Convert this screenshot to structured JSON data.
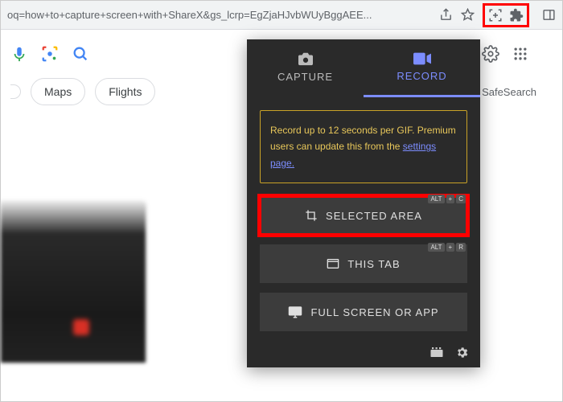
{
  "url_bar": {
    "text": "oq=how+to+capture+screen+with+ShareX&gs_lcrp=EgZjaHJvbWUyBggAEE..."
  },
  "chips": {
    "maps": "Maps",
    "flights": "Flights"
  },
  "safesearch": "SafeSearch",
  "panel": {
    "tabs": {
      "capture": "CAPTURE",
      "record": "RECORD"
    },
    "hint": {
      "line": "Record up to 12 seconds per GIF. Premium users can update this from the ",
      "link": "settings page."
    },
    "buttons": {
      "selected_area": {
        "label": "SELECTED AREA",
        "k1": "ALT",
        "mid": "+",
        "k2": "C"
      },
      "this_tab": {
        "label": "THIS TAB",
        "k1": "ALT",
        "mid": "+",
        "k2": "R"
      },
      "full_screen": {
        "label": "FULL SCREEN OR APP"
      }
    }
  }
}
